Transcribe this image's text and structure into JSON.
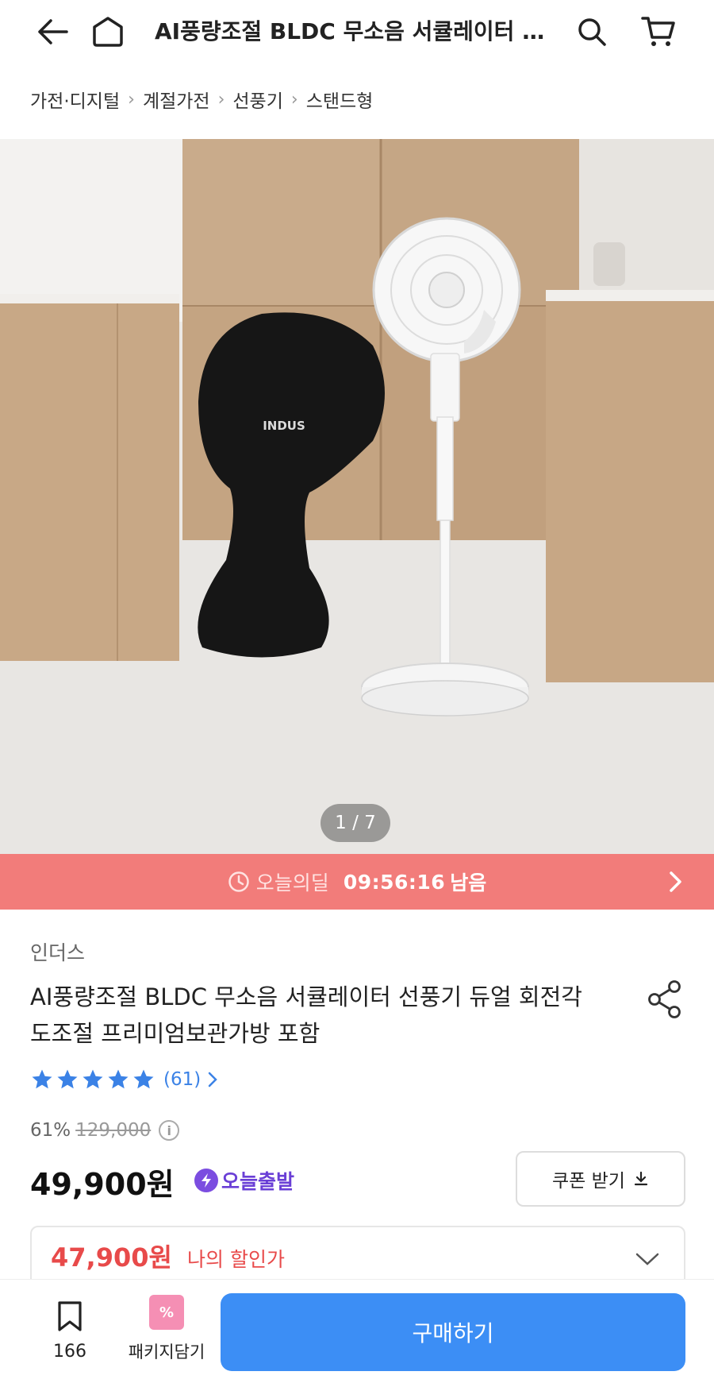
{
  "header": {
    "title": "AI풍량조절 BLDC 무소음 서큘레이터 선풍기 듀얼 회전각도조절 프리미엄보관가방 포함"
  },
  "breadcrumb": [
    "가전·디지털",
    "계절가전",
    "선풍기",
    "스탠드형"
  ],
  "hero": {
    "counter": "1 / 7",
    "cover_logo": "INDUS"
  },
  "deal": {
    "label": "오늘의딜",
    "time": "09:56:16",
    "suffix": "남음"
  },
  "product": {
    "brand": "인더스",
    "title": "AI풍량조절 BLDC 무소음 서큘레이터 선풍기 듀얼 회전각도조절 프리미엄보관가방 포함",
    "rating_stars": 5,
    "review_count": "(61)",
    "discount_rate": "61%",
    "original_price": "129,000",
    "price": "49,900원",
    "delivery_badge": "오늘출발",
    "coupon_label": "쿠폰 받기"
  },
  "my_discount": {
    "price": "47,900원",
    "label": "나의 할인가"
  },
  "bottom_bar": {
    "bookmark_count": "166",
    "package_label": "패키지담기",
    "package_icon_text": "%",
    "buy_label": "구매하기"
  },
  "colors": {
    "deal_banner": "#f27c7a",
    "buy_button": "#3c8ef5",
    "discount_red": "#e84a4a",
    "review_blue": "#3b82e6",
    "today_purple": "#6a3fd6"
  }
}
